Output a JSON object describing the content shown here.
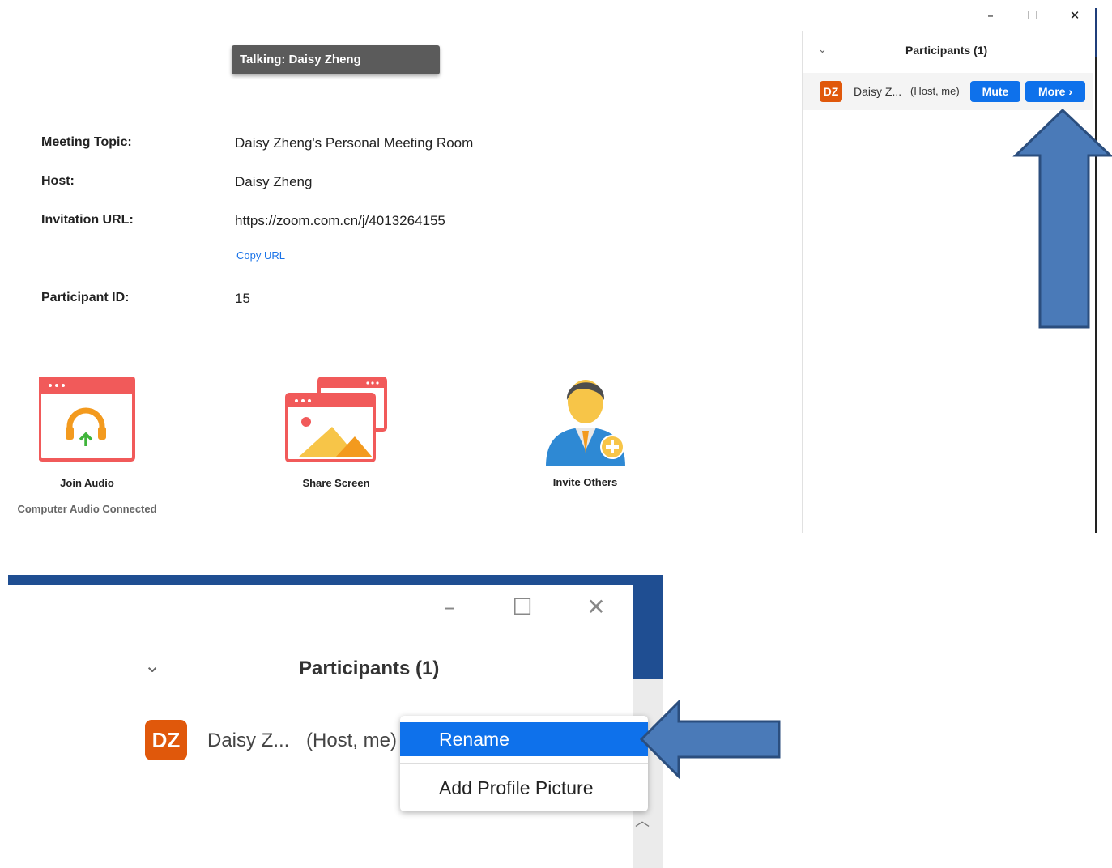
{
  "top_window": {
    "controls": {
      "minimize": "–",
      "maximize": "☐",
      "close": "✕"
    },
    "talking_banner": "Talking: Daisy Zheng",
    "info": {
      "topic_label": "Meeting Topic:",
      "topic_value": "Daisy Zheng's Personal Meeting Room",
      "host_label": "Host:",
      "host_value": "Daisy Zheng",
      "url_label": "Invitation URL:",
      "url_value": "https://zoom.com.cn/j/4013264155",
      "copy_url": "Copy URL",
      "pid_label": "Participant ID:",
      "pid_value": "15"
    },
    "actions": {
      "join_audio": "Join Audio",
      "join_audio_status": "Computer Audio Connected",
      "share_screen": "Share Screen",
      "invite_others": "Invite Others"
    },
    "participants": {
      "title": "Participants (1)",
      "avatar": "DZ",
      "name": "Daisy Z...",
      "role": "(Host, me)",
      "mute": "Mute",
      "more": "More ›"
    }
  },
  "bottom_window": {
    "participants_title": "Participants (1)",
    "avatar": "DZ",
    "name": "Daisy Z...",
    "role": "(Host, me)",
    "menu_items": [
      "Rename",
      "Add Profile Picture"
    ]
  },
  "colors": {
    "accent_blue": "#0e71eb",
    "avatar_orange": "#e0580b",
    "annotation_arrow": "#4a7ab8",
    "window_frame_blue": "#1f4e92"
  }
}
